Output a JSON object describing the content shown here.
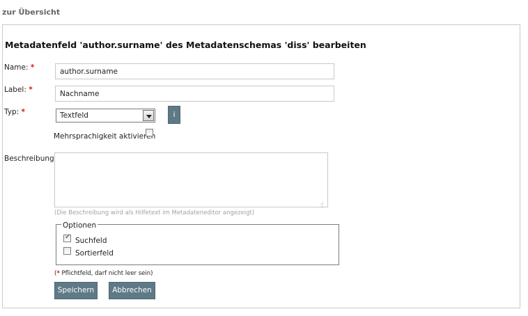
{
  "nav": {
    "back_label": "zur Übersicht"
  },
  "header": {
    "title": "Metadatenfeld 'author.surname' des Metadatenschemas 'diss' bearbeiten"
  },
  "form": {
    "name": {
      "label": "Name:",
      "required_mark": "*",
      "value": "author.surname"
    },
    "label_field": {
      "label": "Label:",
      "required_mark": "*",
      "value": "Nachname"
    },
    "type": {
      "label": "Typ:",
      "required_mark": "*",
      "selected": "Textfeld",
      "info_label": "i"
    },
    "multilang": {
      "label": "Mehrsprachigkeit aktivieren",
      "checked": false
    },
    "description": {
      "label": "Beschreibung:",
      "value": "",
      "hint": "(Die Beschreibung wird als Hilfetext im Metadateneditor angezeigt)"
    },
    "options": {
      "legend": "Optionen",
      "items": [
        {
          "label": "Suchfeld",
          "checked": true
        },
        {
          "label": "Sortierfeld",
          "checked": false
        }
      ]
    },
    "required_note": {
      "open": "(",
      "mark": "*",
      "text": " Pflichtfeld, darf nicht leer sein)"
    },
    "buttons": {
      "save": "Speichern",
      "cancel": "Abbrechen"
    }
  },
  "colors": {
    "required": "#d21a1a",
    "button_bg": "#5f7a86",
    "border": "#c8c8c8"
  }
}
